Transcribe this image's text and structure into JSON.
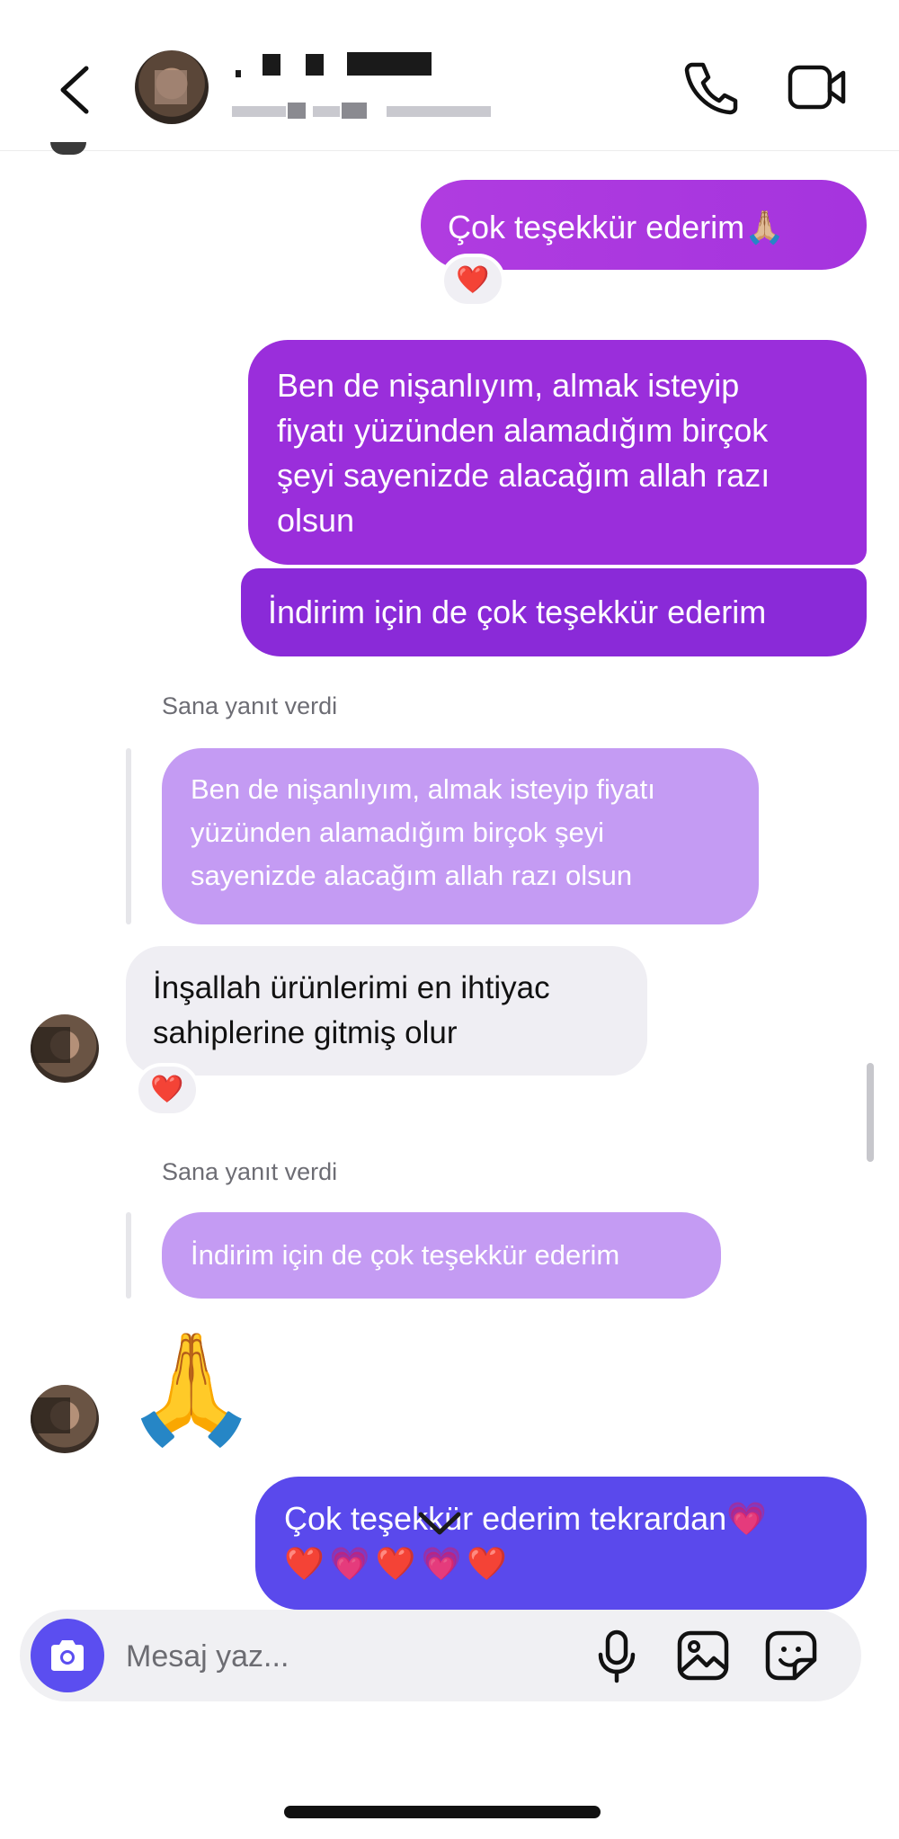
{
  "header": {
    "contact_name": "",
    "contact_status": "",
    "icons": {
      "back": "chevron-left-icon",
      "call": "phone-icon",
      "video": "video-camera-icon"
    }
  },
  "messages": [
    {
      "direction": "outgoing",
      "lines": [
        "Çok teşekkür ederim🙏🏼"
      ],
      "reaction": "❤️"
    },
    {
      "direction": "outgoing",
      "lines": [
        "Ben de nişanlıyım, almak isteyip",
        "fiyatı yüzünden alamadığım birçok",
        "şeyi sayenizde alacağım allah razı",
        "olsun"
      ]
    },
    {
      "direction": "outgoing",
      "lines": [
        "İndirim için de çok teşekkür ederim"
      ]
    },
    {
      "direction": "incoming",
      "reply_label": "Sana yanıt verdi",
      "quoted_lines": [
        "Ben de nişanlıyım, almak isteyip fiyatı",
        "yüzünden alamadığım birçok şeyi",
        "sayenizde alacağım allah razı olsun"
      ],
      "lines": [
        "İnşallah ürünlerimi en ihtiyac",
        "sahiplerine gitmiş olur"
      ],
      "reaction": "❤️"
    },
    {
      "direction": "incoming",
      "reply_label": "Sana yanıt verdi",
      "quoted_lines": [
        "İndirim için de çok teşekkür ederim"
      ],
      "emoji": "🙏"
    },
    {
      "direction": "outgoing",
      "lines": [
        "Çok teşekkür ederim tekrardan💗",
        "❤️💗❤️💗❤️"
      ]
    }
  ],
  "composer": {
    "placeholder": "Mesaj yaz...",
    "icons": {
      "camera": "camera-icon",
      "mic": "microphone-icon",
      "gallery": "image-gallery-icon",
      "sticker": "sticker-icon"
    }
  },
  "colors": {
    "outgoing_bubble": "#9a2edb",
    "last_outgoing_bubble": "#5a49ec",
    "quoted_bubble": "#c49bf3",
    "incoming_bubble": "#efeef3",
    "accent": "#5b4ef0"
  }
}
